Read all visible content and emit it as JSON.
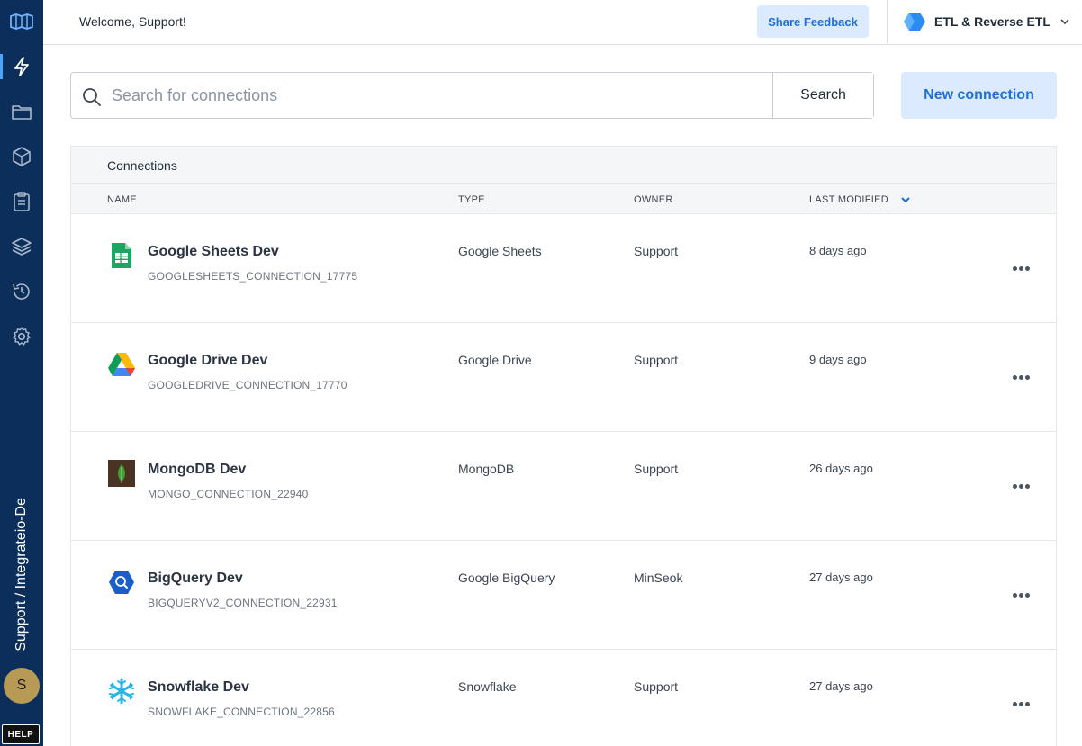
{
  "header": {
    "welcome": "Welcome, Support!",
    "share_feedback": "Share Feedback",
    "product_switcher": "ETL & Reverse ETL"
  },
  "sidebar": {
    "items": [
      {
        "icon": "lightning-icon",
        "active": true
      },
      {
        "icon": "folder-icon"
      },
      {
        "icon": "package-icon"
      },
      {
        "icon": "clipboard-icon"
      },
      {
        "icon": "layers-icon"
      },
      {
        "icon": "history-icon"
      },
      {
        "icon": "gear-icon"
      }
    ],
    "workspace_path": "Support / Integrateio-De",
    "avatar_initial": "S",
    "help_label": "HELP"
  },
  "search": {
    "placeholder": "Search for connections",
    "value": "",
    "button_label": "Search"
  },
  "actions": {
    "new_connection": "New connection"
  },
  "table": {
    "title": "Connections",
    "columns": {
      "name": "NAME",
      "type": "TYPE",
      "owner": "OWNER",
      "last_modified": "LAST MODIFIED"
    },
    "sort_column": "LAST MODIFIED",
    "rows": [
      {
        "name": "Google Sheets Dev",
        "id": "GOOGLESHEETS_CONNECTION_17775",
        "type": "Google Sheets",
        "owner": "Support",
        "modified": "8 days ago",
        "icon": "google-sheets-icon"
      },
      {
        "name": "Google Drive Dev",
        "id": "GOOGLEDRIVE_CONNECTION_17770",
        "type": "Google Drive",
        "owner": "Support",
        "modified": "9 days ago",
        "icon": "google-drive-icon"
      },
      {
        "name": "MongoDB Dev",
        "id": "MONGO_CONNECTION_22940",
        "type": "MongoDB",
        "owner": "Support",
        "modified": "26 days ago",
        "icon": "mongodb-icon"
      },
      {
        "name": "BigQuery Dev",
        "id": "BIGQUERYV2_CONNECTION_22931",
        "type": "Google BigQuery",
        "owner": "MinSeok",
        "modified": "27 days ago",
        "icon": "bigquery-icon"
      },
      {
        "name": "Snowflake Dev",
        "id": "SNOWFLAKE_CONNECTION_22856",
        "type": "Snowflake",
        "owner": "Support",
        "modified": "27 days ago",
        "icon": "snowflake-icon"
      }
    ]
  },
  "colors": {
    "sidebar_bg": "#0c2e5a",
    "accent": "#1d6fd6",
    "accent_light": "#dbeafe"
  }
}
